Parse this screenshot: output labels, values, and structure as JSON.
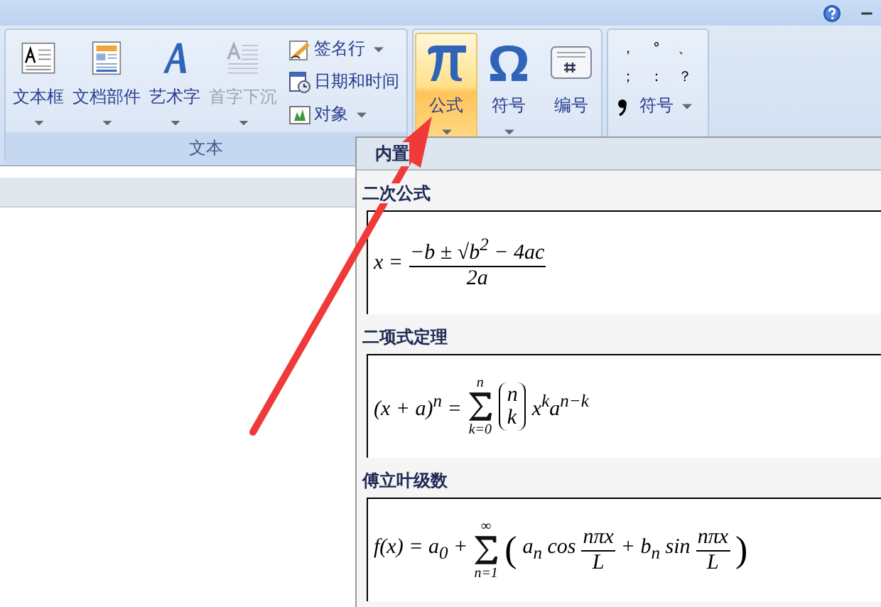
{
  "ribbon": {
    "groups": [
      {
        "label": "文本",
        "large_buttons": [
          {
            "label": "文本框",
            "dropdown": true,
            "disabled": false,
            "selected": false
          },
          {
            "label": "文档部件",
            "dropdown": true,
            "disabled": false,
            "selected": false
          },
          {
            "label": "艺术字",
            "dropdown": true,
            "disabled": false,
            "selected": false
          },
          {
            "label": "首字下沉",
            "dropdown": true,
            "disabled": true,
            "selected": false
          }
        ],
        "small_buttons": [
          {
            "label": "签名行",
            "dropdown": true
          },
          {
            "label": "日期和时间",
            "dropdown": false
          },
          {
            "label": "对象",
            "dropdown": true
          }
        ]
      },
      {
        "large_buttons": [
          {
            "label": "公式",
            "dropdown": true,
            "disabled": false,
            "selected": true
          },
          {
            "label": "符号",
            "dropdown": true,
            "disabled": false,
            "selected": false
          },
          {
            "label": "编号",
            "dropdown": false,
            "disabled": false,
            "selected": false
          }
        ]
      },
      {
        "symbols": [
          "，",
          "°",
          "、",
          "；",
          "：",
          "？"
        ],
        "symbol_button": {
          "label": "符号",
          "dropdown": true
        }
      }
    ]
  },
  "equation_menu": {
    "header": "内置",
    "items": [
      {
        "title": "二次公式",
        "kind": "fraction",
        "lhs": "x =",
        "numerator": "−b ± √b$^{2}$ − 4ac",
        "denominator": "2a"
      },
      {
        "title": "二项式定理",
        "kind": "sum",
        "lhs": "(x + a)$^{n}$ =",
        "upper": "n",
        "lower": "k=0",
        "binom_top": "n",
        "binom_bottom": "k",
        "rest": "x$^{k}$a$^{n−k}$"
      },
      {
        "title": "傅立叶级数",
        "kind": "series",
        "lhs": "f(x) = a$_{0}$ +",
        "upper": "∞",
        "lower": "n=1",
        "open": "(",
        "term1": "a$_{n}$ cos",
        "num1": "nπx",
        "den1": "L",
        "term2": "+ b$_{n}$ sin",
        "num2": "nπx",
        "den2": "L",
        "close": ")"
      }
    ]
  }
}
